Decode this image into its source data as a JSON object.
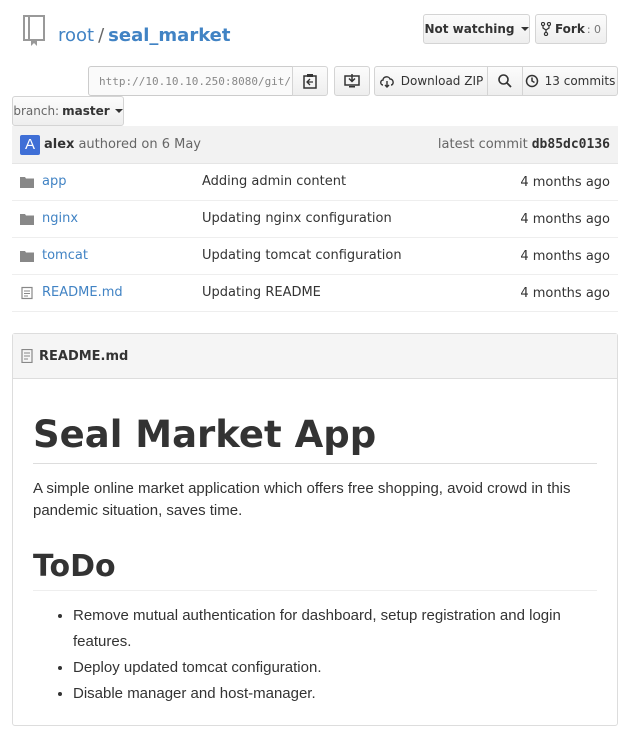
{
  "repo": {
    "owner": "root",
    "separator": "/",
    "name": "seal_market"
  },
  "actions": {
    "watch_label": "Not watching",
    "fork_label": "Fork",
    "fork_count": "0",
    "clone_url": "http://10.10.10.250:8080/git/",
    "download_zip_label": "Download ZIP",
    "commits_label": "13 commits"
  },
  "branch": {
    "label": "branch:",
    "name": "master"
  },
  "commit": {
    "author": "alex",
    "action": "authored on 6 May",
    "latest_label": "latest commit",
    "sha": "db85dc0136",
    "avatar_letter": "A"
  },
  "files": [
    {
      "name": "app",
      "type": "folder",
      "message": "Adding admin content",
      "age": "4 months ago"
    },
    {
      "name": "nginx",
      "type": "folder",
      "message": "Updating nginx configuration",
      "age": "4 months ago"
    },
    {
      "name": "tomcat",
      "type": "folder",
      "message": "Updating tomcat configuration",
      "age": "4 months ago"
    },
    {
      "name": "README.md",
      "type": "file",
      "message": "Updating README",
      "age": "4 months ago"
    }
  ],
  "readme": {
    "filename": "README.md",
    "h1": "Seal Market App",
    "intro": "A simple online market application which offers free shopping, avoid crowd in this pandemic situation, saves time.",
    "h2": "ToDo",
    "todo": [
      "Remove mutual authentication for dashboard, setup registration and login features.",
      "Deploy updated tomcat configuration.",
      "Disable manager and host-manager."
    ]
  },
  "colors": {
    "link": "#4183c4",
    "avatar": "#3f6fd6"
  }
}
